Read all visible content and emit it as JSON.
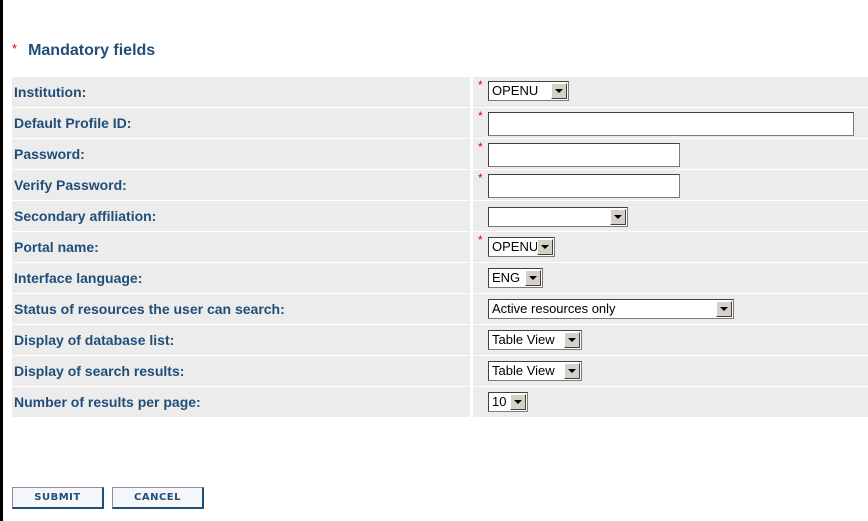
{
  "header": {
    "required_marker": "*",
    "title": "Mandatory fields"
  },
  "fields": [
    {
      "label": "Institution:",
      "required": true,
      "type": "select",
      "value": "OPENU"
    },
    {
      "label": "Default Profile ID:",
      "required": true,
      "type": "text",
      "value": ""
    },
    {
      "label": "Password:",
      "required": true,
      "type": "password",
      "value": ""
    },
    {
      "label": "Verify Password:",
      "required": true,
      "type": "password",
      "value": ""
    },
    {
      "label": "Secondary affiliation:",
      "required": false,
      "type": "select",
      "value": ""
    },
    {
      "label": "Portal name:",
      "required": true,
      "type": "select",
      "value": "OPENU"
    },
    {
      "label": "Interface language:",
      "required": false,
      "type": "select",
      "value": "ENG"
    },
    {
      "label": "Status of resources the user can search:",
      "required": false,
      "type": "select",
      "value": "Active resources only"
    },
    {
      "label": "Display of database list:",
      "required": false,
      "type": "select",
      "value": "Table View"
    },
    {
      "label": "Display of search results:",
      "required": false,
      "type": "select",
      "value": "Table View"
    },
    {
      "label": "Number of results per page:",
      "required": false,
      "type": "select",
      "value": "10"
    }
  ],
  "buttons": {
    "submit": "SUBMIT",
    "cancel": "CANCEL"
  },
  "colors": {
    "label": "#1f4e79",
    "required_star": "#e00000",
    "row_background": "#ececec"
  }
}
